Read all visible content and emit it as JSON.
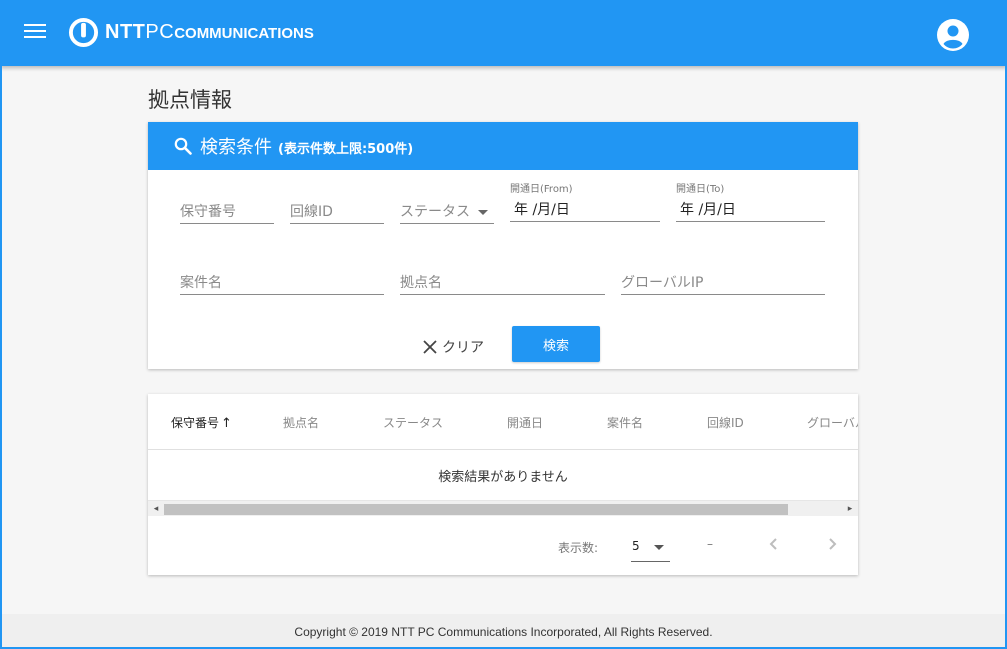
{
  "header": {
    "logo": {
      "nt": "NTT",
      "pc": "PC",
      "comm": "COMMUNICATIONS"
    },
    "icons": {
      "menu": "hamburger-menu-icon",
      "account": "account-circle-icon"
    },
    "colors": {
      "primary": "#2196f3"
    }
  },
  "page": {
    "title": "拠点情報"
  },
  "search": {
    "title": "検索条件",
    "note": "(表示件数上限:500件)",
    "icon": "search-icon",
    "fields": {
      "maintenance_no": {
        "placeholder": "保守番号"
      },
      "line_id": {
        "placeholder": "回線ID"
      },
      "status": {
        "placeholder": "ステータス"
      },
      "open_from": {
        "label": "開通日(From)",
        "value": "年 /月/日"
      },
      "open_to": {
        "label": "開通日(To)",
        "value": "年 /月/日"
      },
      "case_name": {
        "placeholder": "案件名"
      },
      "site_name": {
        "placeholder": "拠点名"
      },
      "global_ip": {
        "placeholder": "グローバルIP"
      }
    },
    "clear_label": "クリア",
    "search_label": "検索"
  },
  "results": {
    "columns": [
      "保守番号",
      "拠点名",
      "ステータス",
      "開通日",
      "案件名",
      "回線ID",
      "グローバル"
    ],
    "sort_indicator": "↑",
    "empty_message": "検索結果がありません",
    "scroll": {
      "left": "◂",
      "right": "▸"
    }
  },
  "pagination": {
    "label": "表示数:",
    "page_size": "5",
    "range": "–"
  },
  "footer": {
    "copyright": "Copyright © 2019 NTT PC Communications Incorporated, All Rights Reserved."
  }
}
